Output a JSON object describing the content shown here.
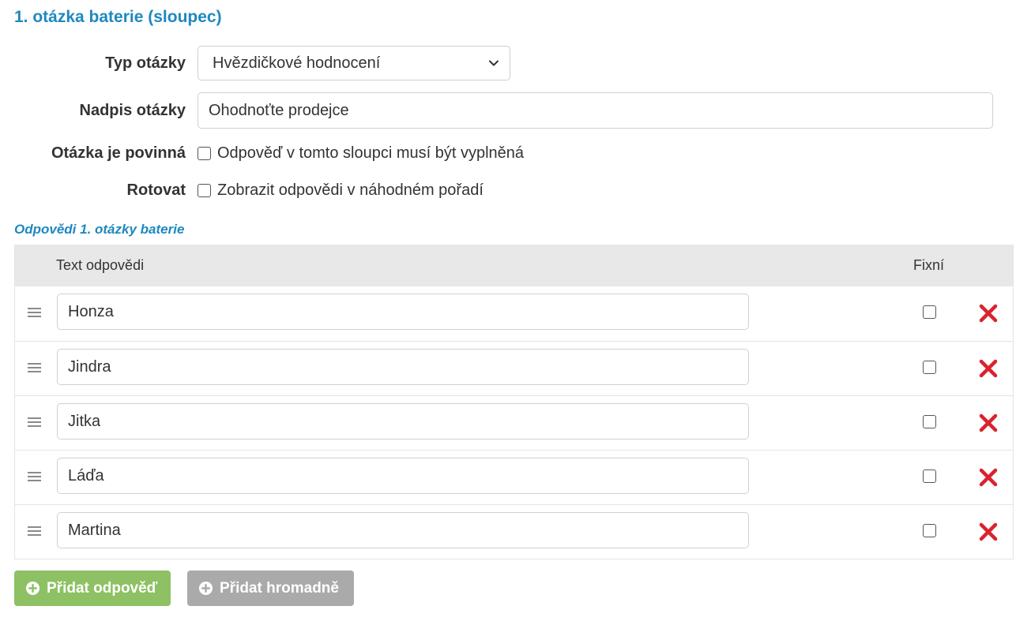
{
  "section": {
    "title": "1. otázka baterie (sloupec)"
  },
  "form": {
    "type_label": "Typ otázky",
    "type_value": "Hvězdičkové hodnocení",
    "heading_label": "Nadpis otázky",
    "heading_value": "Ohodnoťte prodejce",
    "required_label": "Otázka je povinná",
    "required_text": "Odpověď v tomto sloupci musí být vyplněná",
    "rotate_label": "Rotovat",
    "rotate_text": "Zobrazit odpovědi v náhodném pořadí"
  },
  "answers": {
    "heading": "Odpovědi 1. otázky baterie",
    "col_text": "Text odpovědi",
    "col_fixed": "Fixní",
    "rows": [
      {
        "text": "Honza"
      },
      {
        "text": "Jindra"
      },
      {
        "text": "Jitka"
      },
      {
        "text": "Láďa"
      },
      {
        "text": "Martina"
      }
    ]
  },
  "buttons": {
    "add": "Přidat odpověď",
    "bulk": "Přidat hromadně"
  },
  "icons": {
    "drag": "drag-handle-icon",
    "delete": "delete-icon",
    "plus": "plus-circle-icon",
    "chevron": "chevron-down-icon"
  },
  "colors": {
    "accent": "#1e88bf",
    "add_button": "#8dc163",
    "bulk_button": "#aaaaaa",
    "delete": "#d9232d"
  }
}
